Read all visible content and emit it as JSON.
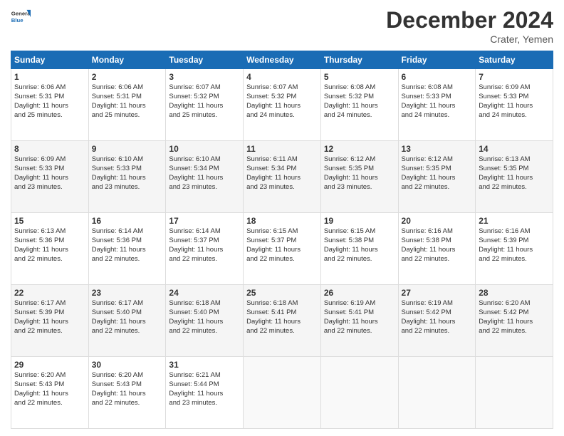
{
  "logo": {
    "line1": "General",
    "line2": "Blue"
  },
  "title": "December 2024",
  "subtitle": "Crater, Yemen",
  "days_header": [
    "Sunday",
    "Monday",
    "Tuesday",
    "Wednesday",
    "Thursday",
    "Friday",
    "Saturday"
  ],
  "weeks": [
    [
      {
        "day": "1",
        "lines": [
          "Sunrise: 6:06 AM",
          "Sunset: 5:31 PM",
          "Daylight: 11 hours",
          "and 25 minutes."
        ]
      },
      {
        "day": "2",
        "lines": [
          "Sunrise: 6:06 AM",
          "Sunset: 5:31 PM",
          "Daylight: 11 hours",
          "and 25 minutes."
        ]
      },
      {
        "day": "3",
        "lines": [
          "Sunrise: 6:07 AM",
          "Sunset: 5:32 PM",
          "Daylight: 11 hours",
          "and 25 minutes."
        ]
      },
      {
        "day": "4",
        "lines": [
          "Sunrise: 6:07 AM",
          "Sunset: 5:32 PM",
          "Daylight: 11 hours",
          "and 24 minutes."
        ]
      },
      {
        "day": "5",
        "lines": [
          "Sunrise: 6:08 AM",
          "Sunset: 5:32 PM",
          "Daylight: 11 hours",
          "and 24 minutes."
        ]
      },
      {
        "day": "6",
        "lines": [
          "Sunrise: 6:08 AM",
          "Sunset: 5:33 PM",
          "Daylight: 11 hours",
          "and 24 minutes."
        ]
      },
      {
        "day": "7",
        "lines": [
          "Sunrise: 6:09 AM",
          "Sunset: 5:33 PM",
          "Daylight: 11 hours",
          "and 24 minutes."
        ]
      }
    ],
    [
      {
        "day": "8",
        "lines": [
          "Sunrise: 6:09 AM",
          "Sunset: 5:33 PM",
          "Daylight: 11 hours",
          "and 23 minutes."
        ]
      },
      {
        "day": "9",
        "lines": [
          "Sunrise: 6:10 AM",
          "Sunset: 5:33 PM",
          "Daylight: 11 hours",
          "and 23 minutes."
        ]
      },
      {
        "day": "10",
        "lines": [
          "Sunrise: 6:10 AM",
          "Sunset: 5:34 PM",
          "Daylight: 11 hours",
          "and 23 minutes."
        ]
      },
      {
        "day": "11",
        "lines": [
          "Sunrise: 6:11 AM",
          "Sunset: 5:34 PM",
          "Daylight: 11 hours",
          "and 23 minutes."
        ]
      },
      {
        "day": "12",
        "lines": [
          "Sunrise: 6:12 AM",
          "Sunset: 5:35 PM",
          "Daylight: 11 hours",
          "and 23 minutes."
        ]
      },
      {
        "day": "13",
        "lines": [
          "Sunrise: 6:12 AM",
          "Sunset: 5:35 PM",
          "Daylight: 11 hours",
          "and 22 minutes."
        ]
      },
      {
        "day": "14",
        "lines": [
          "Sunrise: 6:13 AM",
          "Sunset: 5:35 PM",
          "Daylight: 11 hours",
          "and 22 minutes."
        ]
      }
    ],
    [
      {
        "day": "15",
        "lines": [
          "Sunrise: 6:13 AM",
          "Sunset: 5:36 PM",
          "Daylight: 11 hours",
          "and 22 minutes."
        ]
      },
      {
        "day": "16",
        "lines": [
          "Sunrise: 6:14 AM",
          "Sunset: 5:36 PM",
          "Daylight: 11 hours",
          "and 22 minutes."
        ]
      },
      {
        "day": "17",
        "lines": [
          "Sunrise: 6:14 AM",
          "Sunset: 5:37 PM",
          "Daylight: 11 hours",
          "and 22 minutes."
        ]
      },
      {
        "day": "18",
        "lines": [
          "Sunrise: 6:15 AM",
          "Sunset: 5:37 PM",
          "Daylight: 11 hours",
          "and 22 minutes."
        ]
      },
      {
        "day": "19",
        "lines": [
          "Sunrise: 6:15 AM",
          "Sunset: 5:38 PM",
          "Daylight: 11 hours",
          "and 22 minutes."
        ]
      },
      {
        "day": "20",
        "lines": [
          "Sunrise: 6:16 AM",
          "Sunset: 5:38 PM",
          "Daylight: 11 hours",
          "and 22 minutes."
        ]
      },
      {
        "day": "21",
        "lines": [
          "Sunrise: 6:16 AM",
          "Sunset: 5:39 PM",
          "Daylight: 11 hours",
          "and 22 minutes."
        ]
      }
    ],
    [
      {
        "day": "22",
        "lines": [
          "Sunrise: 6:17 AM",
          "Sunset: 5:39 PM",
          "Daylight: 11 hours",
          "and 22 minutes."
        ]
      },
      {
        "day": "23",
        "lines": [
          "Sunrise: 6:17 AM",
          "Sunset: 5:40 PM",
          "Daylight: 11 hours",
          "and 22 minutes."
        ]
      },
      {
        "day": "24",
        "lines": [
          "Sunrise: 6:18 AM",
          "Sunset: 5:40 PM",
          "Daylight: 11 hours",
          "and 22 minutes."
        ]
      },
      {
        "day": "25",
        "lines": [
          "Sunrise: 6:18 AM",
          "Sunset: 5:41 PM",
          "Daylight: 11 hours",
          "and 22 minutes."
        ]
      },
      {
        "day": "26",
        "lines": [
          "Sunrise: 6:19 AM",
          "Sunset: 5:41 PM",
          "Daylight: 11 hours",
          "and 22 minutes."
        ]
      },
      {
        "day": "27",
        "lines": [
          "Sunrise: 6:19 AM",
          "Sunset: 5:42 PM",
          "Daylight: 11 hours",
          "and 22 minutes."
        ]
      },
      {
        "day": "28",
        "lines": [
          "Sunrise: 6:20 AM",
          "Sunset: 5:42 PM",
          "Daylight: 11 hours",
          "and 22 minutes."
        ]
      }
    ],
    [
      {
        "day": "29",
        "lines": [
          "Sunrise: 6:20 AM",
          "Sunset: 5:43 PM",
          "Daylight: 11 hours",
          "and 22 minutes."
        ]
      },
      {
        "day": "30",
        "lines": [
          "Sunrise: 6:20 AM",
          "Sunset: 5:43 PM",
          "Daylight: 11 hours",
          "and 22 minutes."
        ]
      },
      {
        "day": "31",
        "lines": [
          "Sunrise: 6:21 AM",
          "Sunset: 5:44 PM",
          "Daylight: 11 hours",
          "and 23 minutes."
        ]
      },
      null,
      null,
      null,
      null
    ]
  ]
}
